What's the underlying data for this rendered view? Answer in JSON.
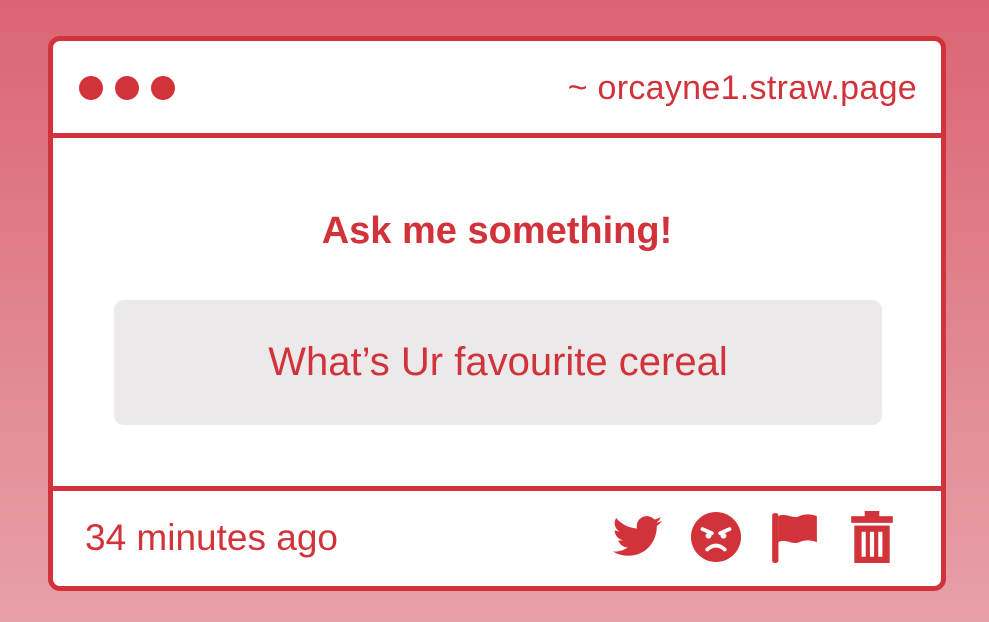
{
  "window": {
    "url": "~ orcayne1.straw.page"
  },
  "card": {
    "prompt": "Ask me something!",
    "question": "What’s Ur favourite cereal",
    "timestamp": "34 minutes ago"
  },
  "actions": [
    {
      "icon": "twitter-icon"
    },
    {
      "icon": "angry-face-icon"
    },
    {
      "icon": "flag-icon"
    },
    {
      "icon": "trash-icon"
    }
  ],
  "colors": {
    "accent": "#d23239",
    "question_bg": "#ebe9ea",
    "background_top": "#db6472",
    "background_bottom": "#e8a0a8"
  }
}
